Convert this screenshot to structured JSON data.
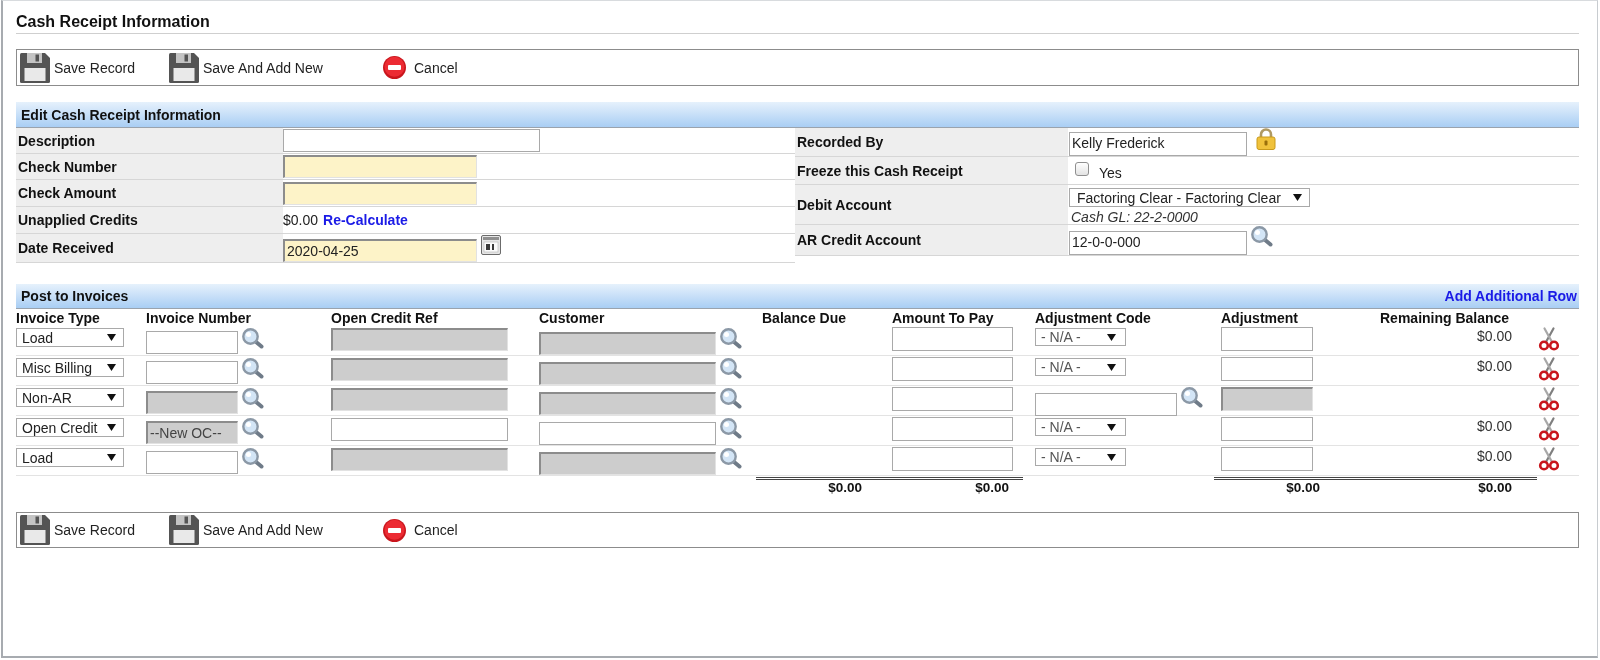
{
  "page_title": "Cash Receipt Information",
  "toolbar_top": [
    {
      "kind": "save",
      "label": "Save Record"
    },
    {
      "kind": "save_new",
      "label": "Save And Add New"
    },
    {
      "kind": "cancel",
      "label": "Cancel"
    }
  ],
  "edit_section": {
    "title": "Edit Cash Receipt Information",
    "left_fields": [
      {
        "label": "Description",
        "kind": "input",
        "required": false
      },
      {
        "label": "Check Number",
        "kind": "input",
        "required": true
      },
      {
        "label": "Check Amount",
        "kind": "input",
        "required": true
      },
      {
        "label": "Unapplied Credits",
        "kind": "amount",
        "value": "$0.00",
        "link": "Re-Calculate"
      },
      {
        "label": "Date Received",
        "kind": "date",
        "value": "2020-04-25",
        "required": true
      }
    ],
    "right_fields": [
      {
        "label": "Recorded By",
        "kind": "locked",
        "value": "Kelly Frederick"
      },
      {
        "label": "Freeze this Cash Receipt",
        "kind": "checkbox",
        "option": "Yes",
        "checked": false
      },
      {
        "label": "Debit Account",
        "kind": "select",
        "value": "Factoring Clear - Factoring Clear",
        "note": "Cash GL: 22-2-0000"
      },
      {
        "label": "AR Credit Account",
        "kind": "lookup",
        "value": "12-0-0-000"
      }
    ]
  },
  "invoices": {
    "title": "Post to Invoices",
    "add_row_link": "Add Additional Row",
    "columns": [
      "Invoice Type",
      "Invoice Number",
      "Open Credit Ref",
      "Customer",
      "Balance Due",
      "Amount To Pay",
      "Adjustment Code",
      "Adjustment",
      "Remaining Balance"
    ],
    "rows": [
      {
        "invoice_type": "Load",
        "invoice_number": {
          "disabled": false
        },
        "open_credit_ref": {
          "disabled": true
        },
        "customer": {
          "disabled": true
        },
        "adjustment_code": {
          "kind": "select",
          "value": "- N/A -"
        },
        "adjustment": {
          "disabled": false
        },
        "remaining_balance": "$0.00"
      },
      {
        "invoice_type": "Misc Billing",
        "invoice_number": {
          "disabled": false
        },
        "open_credit_ref": {
          "disabled": true
        },
        "customer": {
          "disabled": true
        },
        "adjustment_code": {
          "kind": "select",
          "value": "- N/A -"
        },
        "adjustment": {
          "disabled": false
        },
        "remaining_balance": "$0.00"
      },
      {
        "invoice_type": "Non-AR",
        "invoice_number": {
          "disabled": true
        },
        "open_credit_ref": {
          "disabled": true
        },
        "customer": {
          "disabled": true
        },
        "adjustment_code": {
          "kind": "lookup"
        },
        "adjustment": {
          "disabled": true
        }
      },
      {
        "invoice_type": "Open Credit",
        "invoice_number": {
          "disabled": true,
          "value": "--New OC--"
        },
        "open_credit_ref": {
          "disabled": false
        },
        "customer": {
          "disabled": false
        },
        "adjustment_code": {
          "kind": "select",
          "value": "- N/A -"
        },
        "adjustment": {
          "disabled": false
        },
        "remaining_balance": "$0.00"
      },
      {
        "invoice_type": "Load",
        "invoice_number": {
          "disabled": false
        },
        "open_credit_ref": {
          "disabled": true
        },
        "customer": {
          "disabled": true
        },
        "adjustment_code": {
          "kind": "select",
          "value": "- N/A -"
        },
        "adjustment": {
          "disabled": false
        },
        "remaining_balance": "$0.00"
      }
    ],
    "totals": {
      "balance_due": "$0.00",
      "amount_to_pay": "$0.00",
      "adjustment": "$0.00",
      "remaining_balance": "$0.00"
    }
  },
  "toolbar_bottom": [
    {
      "kind": "save",
      "label": "Save Record"
    },
    {
      "kind": "save_new",
      "label": "Save And Add New"
    },
    {
      "kind": "cancel",
      "label": "Cancel"
    }
  ]
}
